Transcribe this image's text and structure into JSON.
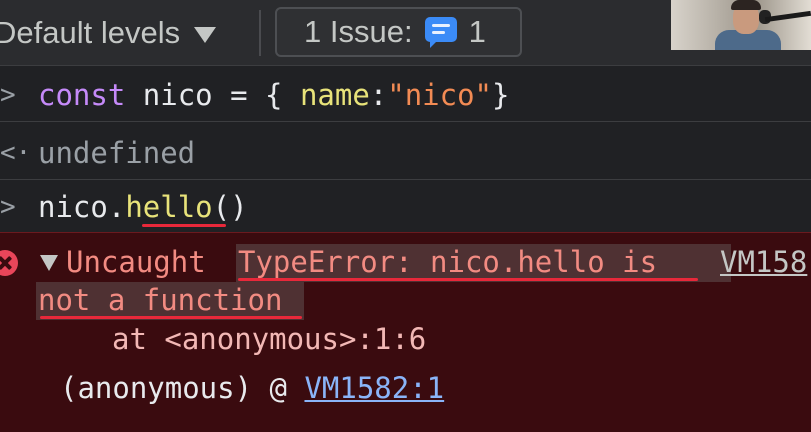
{
  "toolbar": {
    "levels_label": "Default levels",
    "issues_label": "1 Issue:",
    "issues_count": "1"
  },
  "console": {
    "lines": [
      {
        "prompt": ">",
        "tokens": {
          "kw": "const",
          "name": "nico",
          "eq": " = { ",
          "prop": "name",
          "colon": ":",
          "str": "\"nico\"",
          "close": "}"
        }
      },
      {
        "prompt": "<·",
        "result": "undefined"
      },
      {
        "prompt": ">",
        "obj": "nico",
        "dot": ".",
        "method": "hello",
        "parens": "()"
      }
    ],
    "error": {
      "prefix": "Uncaught",
      "message_line1": "TypeError: nico.hello is",
      "message_line2": "not a function",
      "source": "VM158",
      "stack_line": "at <anonymous>:1:6",
      "frame_name": "(anonymous)",
      "frame_at": "@",
      "frame_link": "VM1582:1"
    }
  },
  "colors": {
    "background": "#202124",
    "error_bg": "#3a0b0f",
    "error_text": "#f28b82",
    "keyword": "#c58af9",
    "string": "#f28b54",
    "property": "#e8e37a",
    "link": "#8ab4f8",
    "annotation": "#e8283a"
  }
}
